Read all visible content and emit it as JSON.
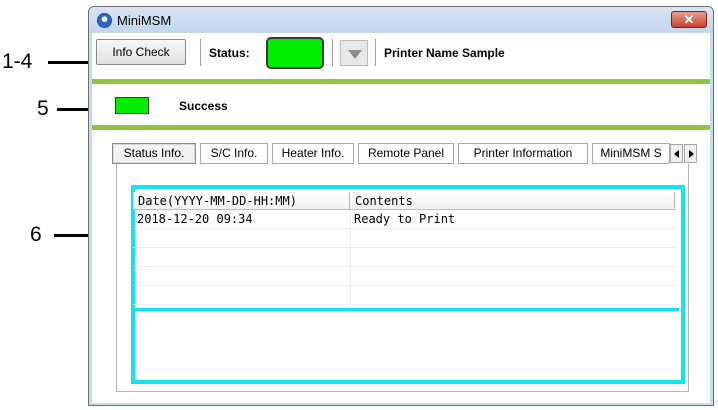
{
  "annotations": [
    {
      "label": "1-4"
    },
    {
      "label": "5"
    },
    {
      "label": "6"
    }
  ],
  "window": {
    "title": "MiniMSM",
    "close_glyph": "✕"
  },
  "toolbar": {
    "info_check_label": "Info Check",
    "status_label": "Status:",
    "status_color": "#00ee00",
    "printer_name": "Printer Name Sample"
  },
  "message": {
    "indicator_color": "#00ee00",
    "text": "Success"
  },
  "accent_colors": {
    "green_bar": "#8cc63e",
    "highlight": "#16e2ee"
  },
  "tabs": [
    {
      "label": "Status Info.",
      "active": true
    },
    {
      "label": "S/C Info."
    },
    {
      "label": "Heater Info."
    },
    {
      "label": "Remote Panel"
    },
    {
      "label": "Printer Information"
    },
    {
      "label": "MiniMSM S"
    }
  ],
  "status_list": {
    "columns": [
      "Date(YYYY-MM-DD-HH:MM)",
      "Contents"
    ],
    "rows": [
      [
        "2018-12-20 09:34",
        "Ready to Print"
      ]
    ]
  }
}
